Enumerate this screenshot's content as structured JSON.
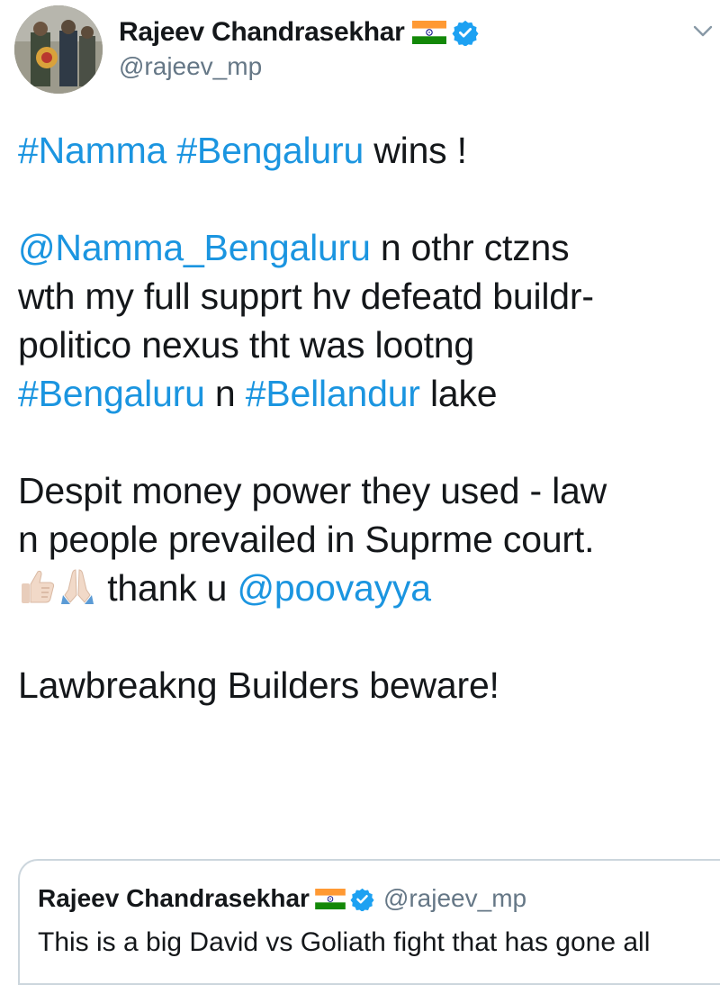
{
  "author": {
    "display_name": "Rajeev Chandrasekhar",
    "handle": "@rajeev_mp",
    "verified": true,
    "flag": "india-flag"
  },
  "tweet": {
    "line1_tag1": "#Namma",
    "line1_tag2": "#Bengaluru",
    "line1_text": " wins !",
    "line2_mention": "@Namma_Bengaluru",
    "line2_text": " n othr ctzns",
    "line3_text": "wth my full supprt hv defeatd buildr-",
    "line4_text": "politico nexus tht was lootng",
    "line5_tag1": "#Bengaluru",
    "line5_text": " n ",
    "line5_tag2": "#Bellandur",
    "line5_text2": " lake",
    "line6_text": "Despit money power they used - law",
    "line7_text": "n people prevailed in Suprme court.",
    "line8_text": " thank u ",
    "line8_mention": "@poovayya",
    "line9_text": "Lawbreakng Builders beware!"
  },
  "emojis": [
    "thumbs-up-icon",
    "folded-hands-icon"
  ],
  "quoted_tweet": {
    "display_name": "Rajeev Chandrasekhar",
    "handle": "@rajeev_mp",
    "text": "This is a big David vs Goliath fight that has gone all"
  },
  "colors": {
    "link": "#1b95e0",
    "text": "#14171a",
    "secondary": "#657786",
    "verified": "#1da1f2",
    "border": "#ccd6dd"
  }
}
